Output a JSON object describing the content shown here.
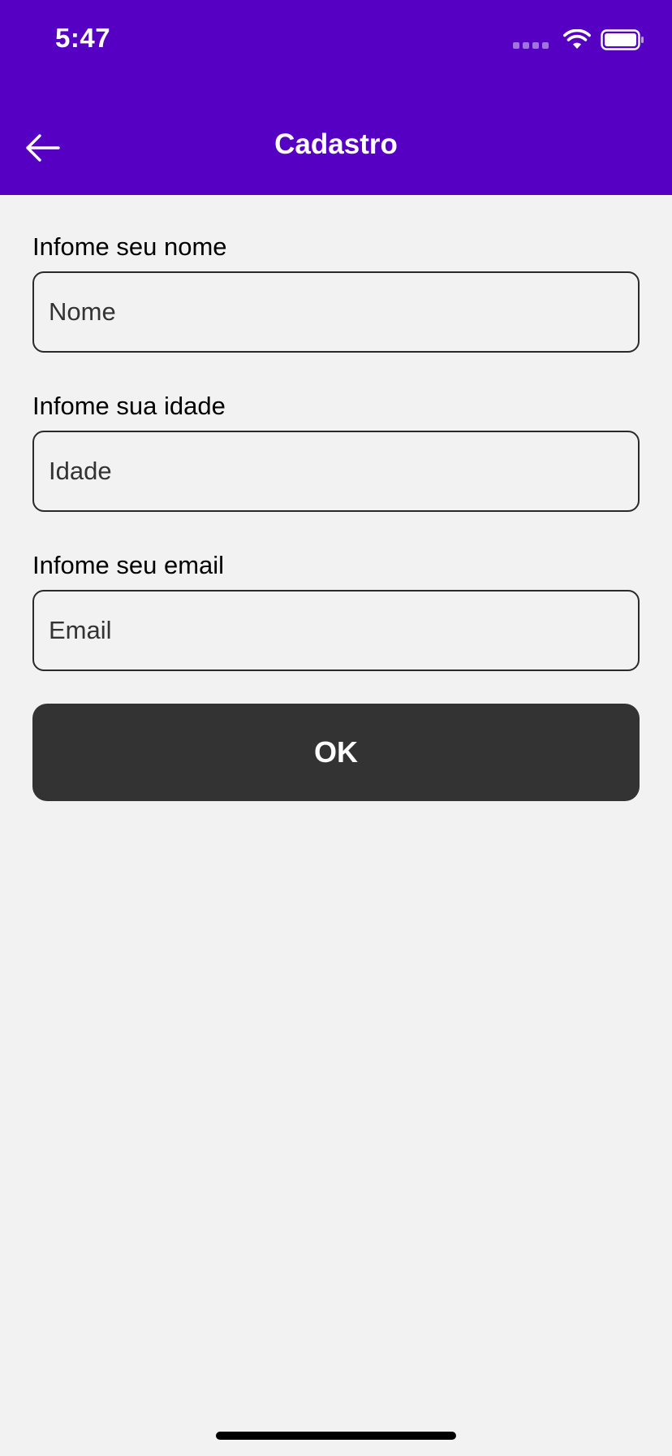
{
  "status_bar": {
    "time": "5:47"
  },
  "nav": {
    "title": "Cadastro",
    "back_icon": "arrow-left-icon"
  },
  "form": {
    "fields": [
      {
        "label": "Infome seu nome",
        "placeholder": "Nome",
        "value": ""
      },
      {
        "label": "Infome sua idade",
        "placeholder": "Idade",
        "value": ""
      },
      {
        "label": "Infome seu email",
        "placeholder": "Email",
        "value": ""
      }
    ],
    "submit_label": "OK"
  },
  "colors": {
    "header_bg": "#5500c2",
    "page_bg": "#f2f2f2",
    "button_bg": "#333333"
  }
}
